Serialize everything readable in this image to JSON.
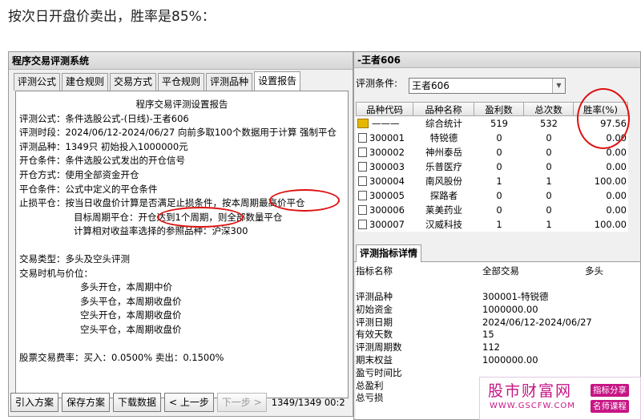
{
  "headline": "按次日开盘价卖出，胜率是85%：",
  "left_window": {
    "title": "程序交易评测系统",
    "tabs": [
      "评测公式",
      "建仓规则",
      "交易方式",
      "平仓规则",
      "评测品种",
      "设置报告"
    ],
    "active_tab": "设置报告",
    "report": {
      "title": "程序交易评测设置报告",
      "lines": [
        "评测公式：条件选股公式-(日线)-王者606",
        "评测时段：2024/06/12-2024/06/27 向前多取100个数据用于计算 强制平仓",
        "评测品种：1349只 初始投入1000000元",
        "开仓条件：条件选股公式发出的开仓信号",
        "开仓方式：使用全部资金开仓",
        "平仓条件：公式中定义的平仓条件",
        "止损平仓：按当日收盘价计算是否满足止损条件，按本周期最高价平仓",
        "目标周期平仓：开仓达到1个周期，则全部数量平仓",
        "计算相对收益率选择的参照品种：沪深300",
        "交易类型：多头及空头评测",
        "交易时机与价位：",
        "多头开仓，本周期中价",
        "多头平仓，本周期收盘价",
        "空头开仓，本周期收盘价",
        "空头平仓，本周期收盘价",
        "股票交易费率：买入：0.0500% 卖出：0.1500%"
      ]
    },
    "buttons": {
      "import": "引入方案",
      "save": "保存方案",
      "download": "下载数据",
      "prev": "< 上一步",
      "next": "下一步 >"
    },
    "status": "1349/1349 00:2"
  },
  "right_window": {
    "title": "-王者606",
    "condition_label": "评测条件:",
    "condition_value": "王者606",
    "grid": {
      "headers": [
        "品种代码",
        "品种名称",
        "盈利数",
        "总次数",
        "胜率(%)"
      ],
      "rows": [
        {
          "code": "———",
          "name": "综合统计",
          "wins": "519",
          "total": "532",
          "rate": "97.56",
          "summary": true
        },
        {
          "code": "300001",
          "name": "特锐德",
          "wins": "0",
          "total": "0",
          "rate": "0.00"
        },
        {
          "code": "300002",
          "name": "神州泰岳",
          "wins": "0",
          "total": "0",
          "rate": "0.00"
        },
        {
          "code": "300003",
          "name": "乐普医疗",
          "wins": "0",
          "total": "0",
          "rate": "0.00"
        },
        {
          "code": "300004",
          "name": "南风股份",
          "wins": "1",
          "total": "1",
          "rate": "100.00"
        },
        {
          "code": "300005",
          "name": "探路者",
          "wins": "0",
          "total": "0",
          "rate": "0.00"
        },
        {
          "code": "300006",
          "name": "莱美药业",
          "wins": "0",
          "total": "0",
          "rate": "0.00"
        },
        {
          "code": "300007",
          "name": "汉威科技",
          "wins": "1",
          "total": "1",
          "rate": "100.00"
        }
      ]
    },
    "detail_tab": "评测指标详情",
    "detail_headers": [
      "指标名称",
      "全部交易",
      "多头"
    ],
    "detail_rows": [
      {
        "name": "评测品种",
        "all": "300001-特锐德",
        "long": ""
      },
      {
        "name": "初始资金",
        "all": "1000000.00",
        "long": ""
      },
      {
        "name": "评测日期",
        "all": "2024/06/12-2024/06/27",
        "long": ""
      },
      {
        "name": "有效天数",
        "all": "15",
        "long": ""
      },
      {
        "name": "评测周期数",
        "all": "112",
        "long": ""
      },
      {
        "name": "期末权益",
        "all": "1000000.00",
        "long": ""
      },
      {
        "name": "盈亏时间比",
        "all": "",
        "long": ""
      },
      {
        "name": "总盈利",
        "all": "",
        "long": ""
      },
      {
        "name": "总亏损",
        "all": "",
        "long": ""
      }
    ]
  },
  "watermark": {
    "name": "股市财富网",
    "url": "WWW.GSCFW.COM",
    "tag1": "指标分享",
    "tag2": "名师课程"
  },
  "annotation_color": "#d11111",
  "accent_color": "#c71585"
}
